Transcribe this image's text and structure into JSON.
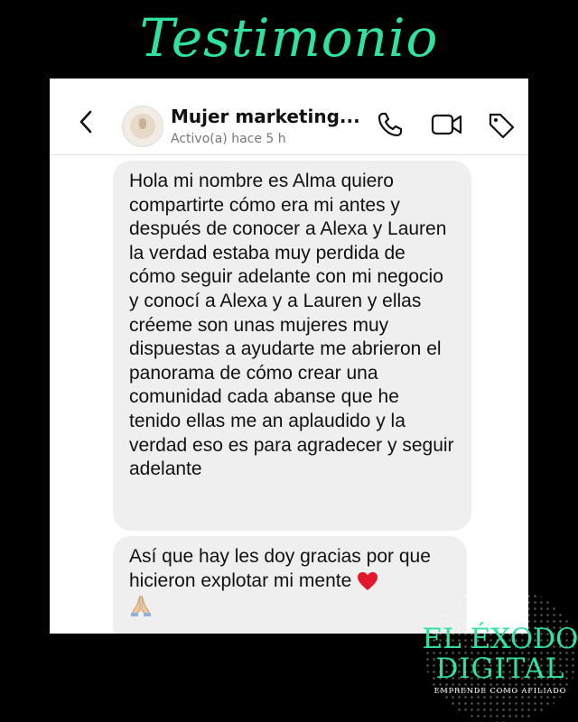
{
  "headline": "Testimonio",
  "header": {
    "contact_name": "Mujer marketing...",
    "status": "Activo(a) hace 5 h"
  },
  "messages": [
    {
      "text": "Hola mi nombre es Alma quiero compartirte cómo era mi antes y después de conocer a Alexa y Lauren la verdad estaba muy perdida de cómo seguir adelante con mi negocio y conocí a Alexa y a Lauren y ellas créeme son unas mujeres muy dispuestas a ayudarte me abrieron el panorama de cómo crear una comunidad cada abanse que he tenido ellas me an aplaudido y la verdad eso es para agradecer y seguir adelante"
    },
    {
      "text": "Así que hay les doy gracias por que hicieron explotar mi mente",
      "emojis": [
        "heart-emoji",
        "praying-hands-emoji"
      ]
    }
  ],
  "logo": {
    "line1": "EL ÉXODO",
    "line2": "DIGITAL",
    "tagline": "EMPRENDE COMO AFILIADO"
  },
  "colors": {
    "accent": "#2fe39e",
    "bubble": "#efefef",
    "background": "#000000"
  }
}
